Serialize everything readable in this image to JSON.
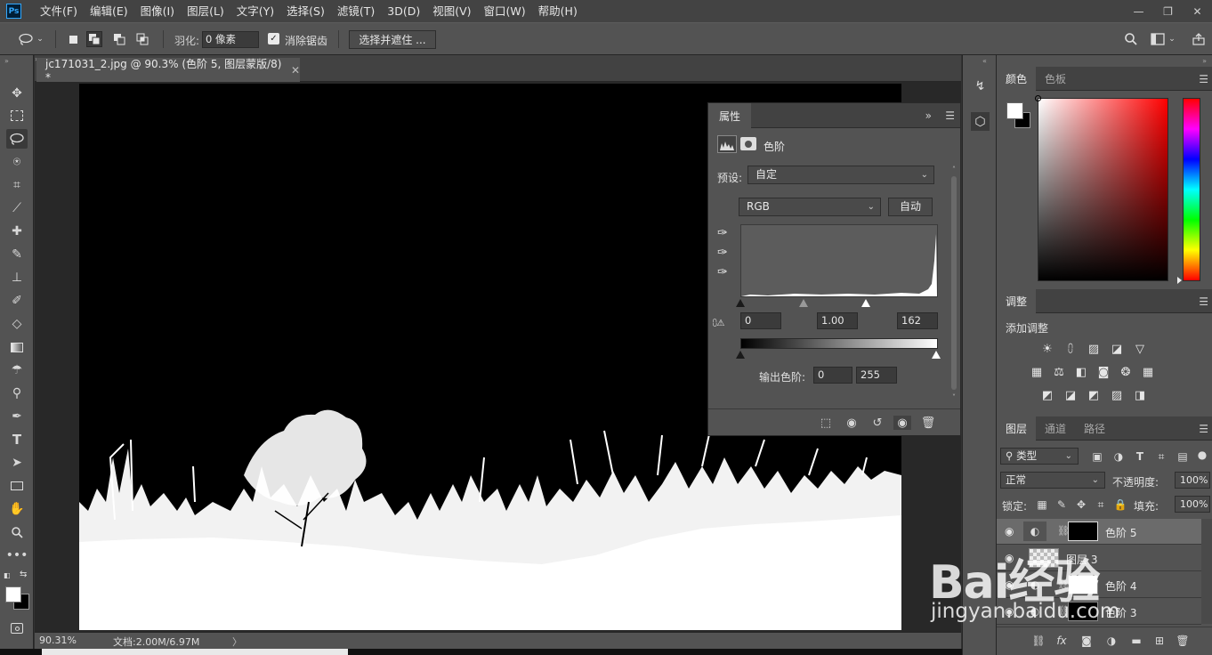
{
  "app": {
    "logo": "Ps"
  },
  "menu": [
    "文件(F)",
    "编辑(E)",
    "图像(I)",
    "图层(L)",
    "文字(Y)",
    "选择(S)",
    "滤镜(T)",
    "3D(D)",
    "视图(V)",
    "窗口(W)",
    "帮助(H)"
  ],
  "window_controls": {
    "minimize": "—",
    "restore": "❐",
    "close": "✕"
  },
  "options": {
    "feather_label": "羽化:",
    "feather_value": "0 像素",
    "antialias_label": "消除锯齿",
    "antialias_checked": "✓",
    "select_mask_label": "选择并遮住 ..."
  },
  "document": {
    "tab_title": "jc171031_2.jpg @ 90.3% (色阶 5, 图层蒙版/8) *",
    "zoom": "90.31%",
    "doc_size": "文档:2.00M/6.97M",
    "arrow": "〉"
  },
  "properties": {
    "tab": "属性",
    "title": "色阶",
    "preset_label": "预设:",
    "preset_value": "自定",
    "channel": "RGB",
    "auto_label": "自动",
    "input_black": "0",
    "input_gamma": "1.00",
    "input_white": "162",
    "output_label": "输出色阶:",
    "output_black": "0",
    "output_white": "255"
  },
  "color_panel": {
    "tabs": [
      "颜色",
      "色板"
    ],
    "foreground": "#ffffff",
    "background": "#000000"
  },
  "adjust_panel": {
    "tab": "调整",
    "subtitle": "添加调整"
  },
  "layers_panel": {
    "tabs": [
      "图层",
      "通道",
      "路径"
    ],
    "filter_label": "类型",
    "blend_mode": "正常",
    "opacity_label": "不透明度:",
    "opacity_value": "100%",
    "lock_label": "锁定:",
    "fill_label": "填充:",
    "fill_value": "100%",
    "layers": [
      {
        "name": "色阶 5",
        "selected": true
      },
      {
        "name": "图层 3",
        "selected": false
      },
      {
        "name": "色阶 4",
        "selected": false
      },
      {
        "name": "色阶 3",
        "selected": false
      }
    ]
  },
  "watermark": {
    "main": "Bai经验",
    "sub": "jingyan.baidu.com"
  }
}
